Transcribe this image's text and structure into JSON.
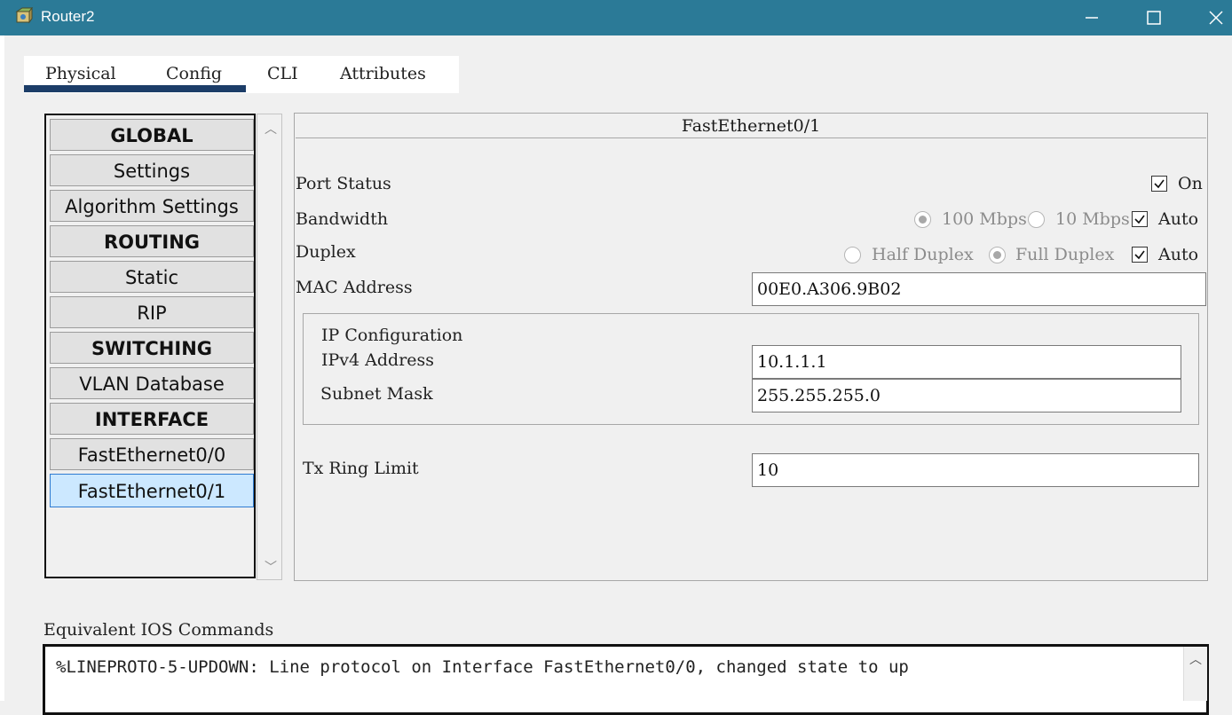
{
  "window": {
    "title": "Router2",
    "controls": {
      "minimize_icon": "minimize-icon",
      "maximize_icon": "maximize-icon",
      "close_icon": "close-icon"
    }
  },
  "tabs": [
    {
      "label": "Physical",
      "active": false
    },
    {
      "label": "Config",
      "active": true
    },
    {
      "label": "CLI",
      "active": false
    },
    {
      "label": "Attributes",
      "active": false
    }
  ],
  "nav": {
    "items": [
      {
        "label": "GLOBAL",
        "section": true
      },
      {
        "label": "Settings",
        "section": false
      },
      {
        "label": "Algorithm Settings",
        "section": false
      },
      {
        "label": "ROUTING",
        "section": true
      },
      {
        "label": "Static",
        "section": false
      },
      {
        "label": "RIP",
        "section": false
      },
      {
        "label": "SWITCHING",
        "section": true
      },
      {
        "label": "VLAN Database",
        "section": false
      },
      {
        "label": "INTERFACE",
        "section": true
      },
      {
        "label": "FastEthernet0/0",
        "section": false
      },
      {
        "label": "FastEthernet0/1",
        "section": false,
        "selected": true
      }
    ]
  },
  "interface": {
    "title": "FastEthernet0/1",
    "port_status": {
      "label": "Port Status",
      "on_label": "On",
      "on_checked": true
    },
    "bandwidth": {
      "label": "Bandwidth",
      "option_100": "100 Mbps",
      "option_10": "10 Mbps",
      "selected": "100 Mbps",
      "auto_label": "Auto",
      "auto_checked": true
    },
    "duplex": {
      "label": "Duplex",
      "option_half": "Half Duplex",
      "option_full": "Full Duplex",
      "selected": "Full Duplex",
      "auto_label": "Auto",
      "auto_checked": true
    },
    "mac": {
      "label": "MAC Address",
      "value": "00E0.A306.9B02"
    },
    "ip_config": {
      "heading": "IP Configuration",
      "ipv4_label": "IPv4 Address",
      "ipv4_value": "10.1.1.1",
      "mask_label": "Subnet Mask",
      "mask_value": "255.255.255.0"
    },
    "tx_ring": {
      "label": "Tx Ring Limit",
      "value": "10"
    }
  },
  "ios": {
    "label": "Equivalent IOS Commands",
    "text": "%LINEPROTO-5-UPDOWN: Line protocol on Interface FastEthernet0/0, changed state to up"
  },
  "colors": {
    "titlebar": "#2b7a97",
    "tab_underline": "#1c3d68",
    "selected_item": "#cce8ff"
  }
}
